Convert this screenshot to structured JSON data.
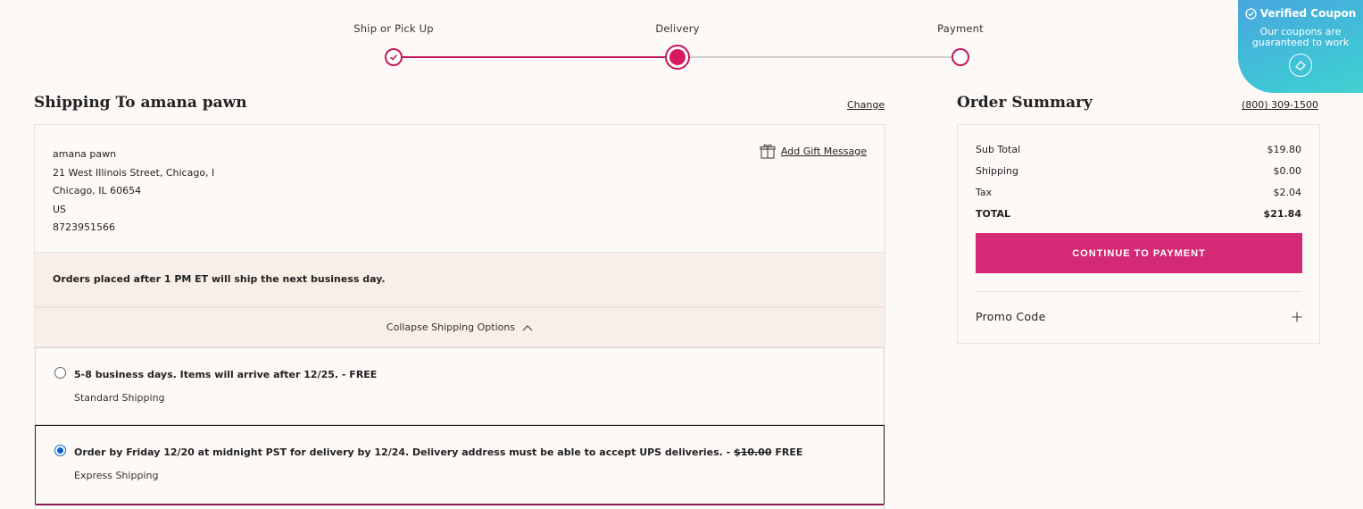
{
  "stepper": {
    "steps": [
      {
        "label": "Ship or Pick Up",
        "state": "complete"
      },
      {
        "label": "Delivery",
        "state": "current"
      },
      {
        "label": "Payment",
        "state": "pending"
      }
    ]
  },
  "coupon": {
    "title": "Verified Coupon",
    "subtitle_line1": "Our coupons are",
    "subtitle_line2": "guaranteed to work"
  },
  "shipping": {
    "title": "Shipping To amana pawn",
    "change_label": "Change",
    "address": {
      "name": "amana pawn",
      "street": "21 West Illinois Street, Chicago, I",
      "city_line": "Chicago, IL 60654",
      "country": "US",
      "phone": "8723951566"
    },
    "gift_label": "Add Gift Message",
    "notice": "Orders placed after 1 PM ET will ship the next business day.",
    "collapse_label": "Collapse Shipping Options",
    "options": [
      {
        "description": "5-8 business days. Items will arrive after 12/25. - FREE",
        "name": "Standard Shipping",
        "selected": false
      },
      {
        "description_prefix": "Order by Friday 12/20 at midnight PST for delivery by 12/24. Delivery address must be able to accept UPS deliveries. - ",
        "original_price": "$10.00",
        "price": "FREE",
        "name": "Express Shipping",
        "selected": true
      }
    ]
  },
  "summary": {
    "title": "Order Summary",
    "phone": "(800) 309-1500",
    "rows": [
      {
        "label": "Sub Total",
        "value": "$19.80"
      },
      {
        "label": "Shipping",
        "value": "$0.00"
      },
      {
        "label": "Tax",
        "value": "$2.04"
      },
      {
        "label": "TOTAL",
        "value": "$21.84"
      }
    ],
    "cta_label": "CONTINUE TO PAYMENT",
    "promo_label": "Promo Code"
  },
  "colors": {
    "accent": "#d42a75",
    "stepper": "#c2185b",
    "coupon_bg": "#3fc6d6",
    "radio_selected": "#0a64d0"
  }
}
